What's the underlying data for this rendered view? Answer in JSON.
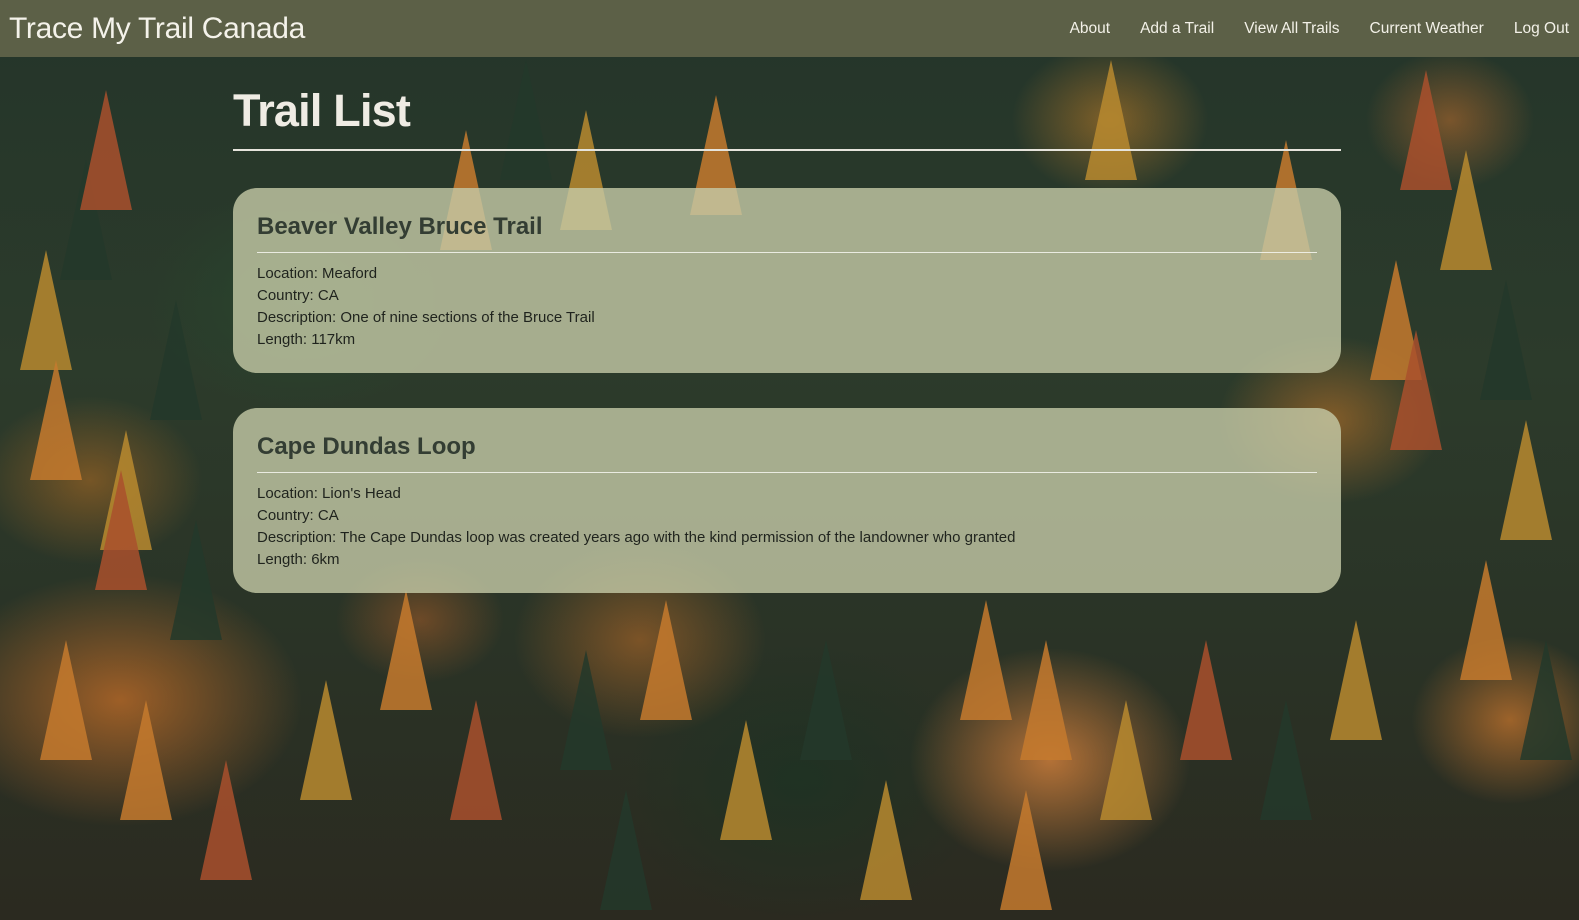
{
  "app": {
    "brand": "Trace My Trail Canada"
  },
  "nav": {
    "items": [
      {
        "label": "About"
      },
      {
        "label": "Add a Trail"
      },
      {
        "label": "View All Trails"
      },
      {
        "label": "Current Weather"
      },
      {
        "label": "Log Out"
      }
    ]
  },
  "page": {
    "title": "Trail List"
  },
  "trails": [
    {
      "name": "Beaver Valley Bruce Trail",
      "location": "Location: Meaford",
      "country": "Country: CA",
      "description": "Description: One of nine sections of the Bruce Trail",
      "length": "Length: 117km"
    },
    {
      "name": "Cape Dundas Loop",
      "location": "Location: Lion's Head",
      "country": "Country: CA",
      "description": "Description: The Cape Dundas loop was created years ago with the kind permission of the landowner who granted",
      "length": "Length: 6km"
    }
  ],
  "colors": {
    "navbar": "#5c6047",
    "card": "#c5caa8",
    "title": "#efece4"
  }
}
